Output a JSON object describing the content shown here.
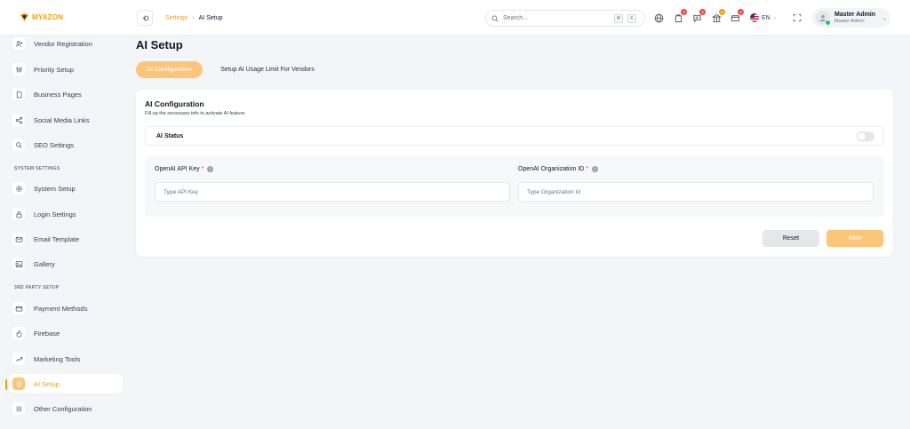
{
  "brand": {
    "name": "MYAZON"
  },
  "header": {
    "breadcrumb": {
      "parent": "Settings",
      "separator": "›",
      "current": "AI Setup"
    },
    "search": {
      "placeholder": "Search...",
      "shortcut_mod": "⌘",
      "shortcut_key": "K"
    },
    "badges": {
      "orders": "3",
      "messages": "3",
      "store": "3",
      "payments": "3"
    },
    "language": "EN",
    "user": {
      "name": "Master Admin",
      "role": "Master Admin"
    }
  },
  "sidebar": {
    "items": [
      {
        "label": "Vendor Registration",
        "icon": "user-add-icon"
      },
      {
        "label": "Priority Setup",
        "icon": "sliders-icon"
      },
      {
        "label": "Business Pages",
        "icon": "file-icon"
      },
      {
        "label": "Social Media Links",
        "icon": "share-icon"
      },
      {
        "label": "SEO Settings",
        "icon": "search-icon"
      }
    ],
    "system_section": "SYSTEM SETTINGS",
    "system_items": [
      {
        "label": "System Setup",
        "icon": "gear-icon"
      },
      {
        "label": "Login Settings",
        "icon": "lock-icon"
      },
      {
        "label": "Email Template",
        "icon": "mail-icon"
      },
      {
        "label": "Gallery",
        "icon": "image-icon"
      }
    ],
    "third_party_section": "3RD PARTY SETUP",
    "third_party_items": [
      {
        "label": "Payment Methods",
        "icon": "card-icon"
      },
      {
        "label": "Firebase",
        "icon": "flame-icon"
      },
      {
        "label": "Marketing Tools",
        "icon": "trend-icon"
      },
      {
        "label": "AI Setup",
        "icon": "ai-chip-icon",
        "active": true
      },
      {
        "label": "Other Configuration",
        "icon": "config-icon"
      }
    ]
  },
  "main": {
    "title": "AI Setup",
    "tabs": [
      {
        "label": "AI Configuration",
        "active": true
      },
      {
        "label": "Setup AI Usage Limit For Vendors",
        "active": false
      }
    ],
    "card": {
      "title": "AI Configuration",
      "subtitle": "Fill up the necessary info to activate AI feature",
      "status_label": "AI Status",
      "status_enabled": false,
      "api_key_label": "OpenAI API Key",
      "api_key_placeholder": "Type API Key",
      "org_label": "OpenAI Organization ID",
      "org_placeholder": "Type Organization Id",
      "required_mark": "*",
      "reset_label": "Reset",
      "save_label": "Save"
    }
  },
  "colors": {
    "accent": "#f59e0b",
    "accent_soft": "#fcc57a",
    "background": "#f3f5f9"
  }
}
